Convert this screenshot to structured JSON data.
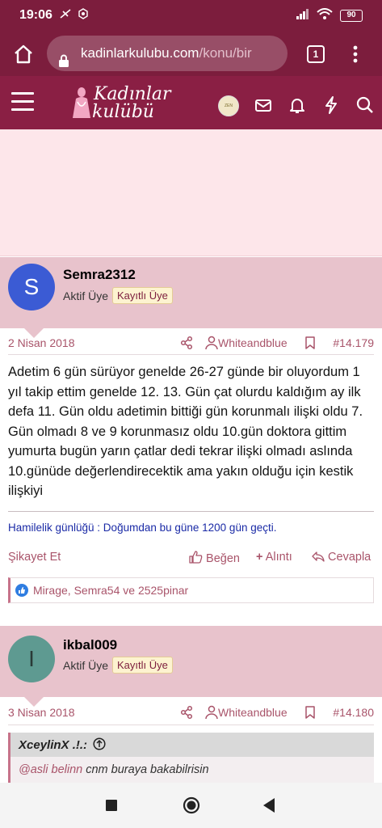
{
  "status": {
    "time": "19:06",
    "battery": "90"
  },
  "browser": {
    "url_domain": "kadinlarkulubu.com",
    "url_path": "/konu/bir",
    "tab_count": "1"
  },
  "site": {
    "logo_line1": "Kadınlar",
    "logo_line2": "kulübü",
    "nav_avatar_text": "ZEN DEFNE"
  },
  "posts": [
    {
      "avatar_letter": "S",
      "avatar_color": "#3b5bd4",
      "username": "Semra2312",
      "role": "Aktif Üye",
      "badge": "Kayıtlı Üye",
      "date": "2 Nisan 2018",
      "author_of_thread": "Whiteandblue",
      "number": "#14.179",
      "text": "Adetim 6 gün sürüyor genelde 26-27 günde bir oluyordum 1 yıl takip ettim genelde 12. 13. Gün çat olurdu kaldığım ay ilk defa 11. Gün oldu adetimin bittiği gün korunmalı ilişki oldu 7. Gün olmadı 8 ve 9 korunmasız oldu 10.gün doktora gittim yumurta bugün yarın çatlar dedi tekrar ilişki olmadı aslında 10.günüde değerlendirecektik ama yakın olduğu için kestik ilişkiyi",
      "signature": "Hamilelik günlüğü : Doğumdan bu güne 1200 gün geçti.",
      "actions": {
        "report": "Şikayet Et",
        "like": "Beğen",
        "quote": "Alıntı",
        "reply": "Cevapla"
      },
      "likes": "Mirage, Semra54 ve 2525pinar"
    },
    {
      "avatar_letter": "I",
      "avatar_color": "#5e9a91",
      "username": "ikbal009",
      "role": "Aktif Üye",
      "badge": "Kayıtlı Üye",
      "date": "3 Nisan 2018",
      "author_of_thread": "Whiteandblue",
      "number": "#14.180",
      "quote_author": "XceylinX .!.:",
      "quote_mention": "@asli belinn",
      "quote_text": " cnm buraya bakabilrisin"
    }
  ],
  "colors": {
    "primary": "#8a1f44",
    "header_bg": "#e8c3cc",
    "accent_text": "#a9546a"
  }
}
